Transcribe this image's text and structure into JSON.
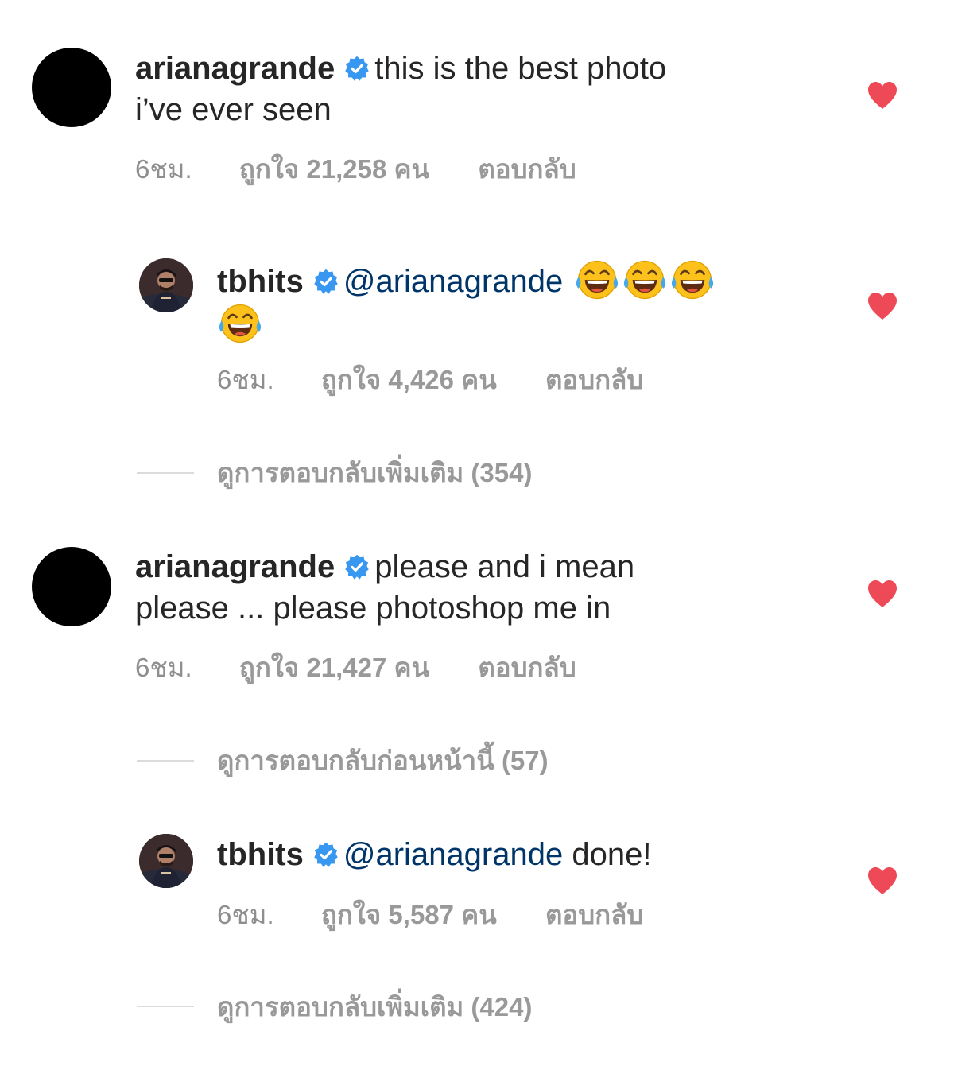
{
  "comments": [
    {
      "username": "arianagrande",
      "text_line1": "this is the best photo",
      "text_line2": "i’ve ever seen",
      "time": "6ชม.",
      "likes": "ถูกใจ 21,258 คน",
      "reply": "ตอบกลับ"
    },
    {
      "username": "tbhits",
      "mention": "@arianagrande",
      "time": "6ชม.",
      "likes": "ถูกใจ 4,426 คน",
      "reply": "ตอบกลับ"
    },
    {
      "username": "arianagrande",
      "text_line1": "please and i mean",
      "text_line2": "please ... please photoshop me in",
      "time": "6ชม.",
      "likes": "ถูกใจ 21,427 คน",
      "reply": "ตอบกลับ"
    },
    {
      "username": "tbhits",
      "mention": "@arianagrande",
      "text": "done!",
      "time": "6ชม.",
      "likes": "ถูกใจ 5,587 คน",
      "reply": "ตอบกลับ"
    }
  ],
  "view_replies": [
    {
      "label": "ดูการตอบกลับเพิ่มเติม (354)"
    },
    {
      "label": "ดูการตอบกลับก่อนหน้านี้ (57)"
    },
    {
      "label": "ดูการตอบกลับเพิ่มเติม (424)"
    }
  ],
  "icons": {
    "verified": "verified-badge-icon",
    "emoji": "face-with-tears-of-joy-emoji",
    "like": "heart-icon"
  },
  "colors": {
    "heart": "#ed4956",
    "verified": "#3897f0",
    "mention": "#003569",
    "meta": "#8e8e8e"
  }
}
